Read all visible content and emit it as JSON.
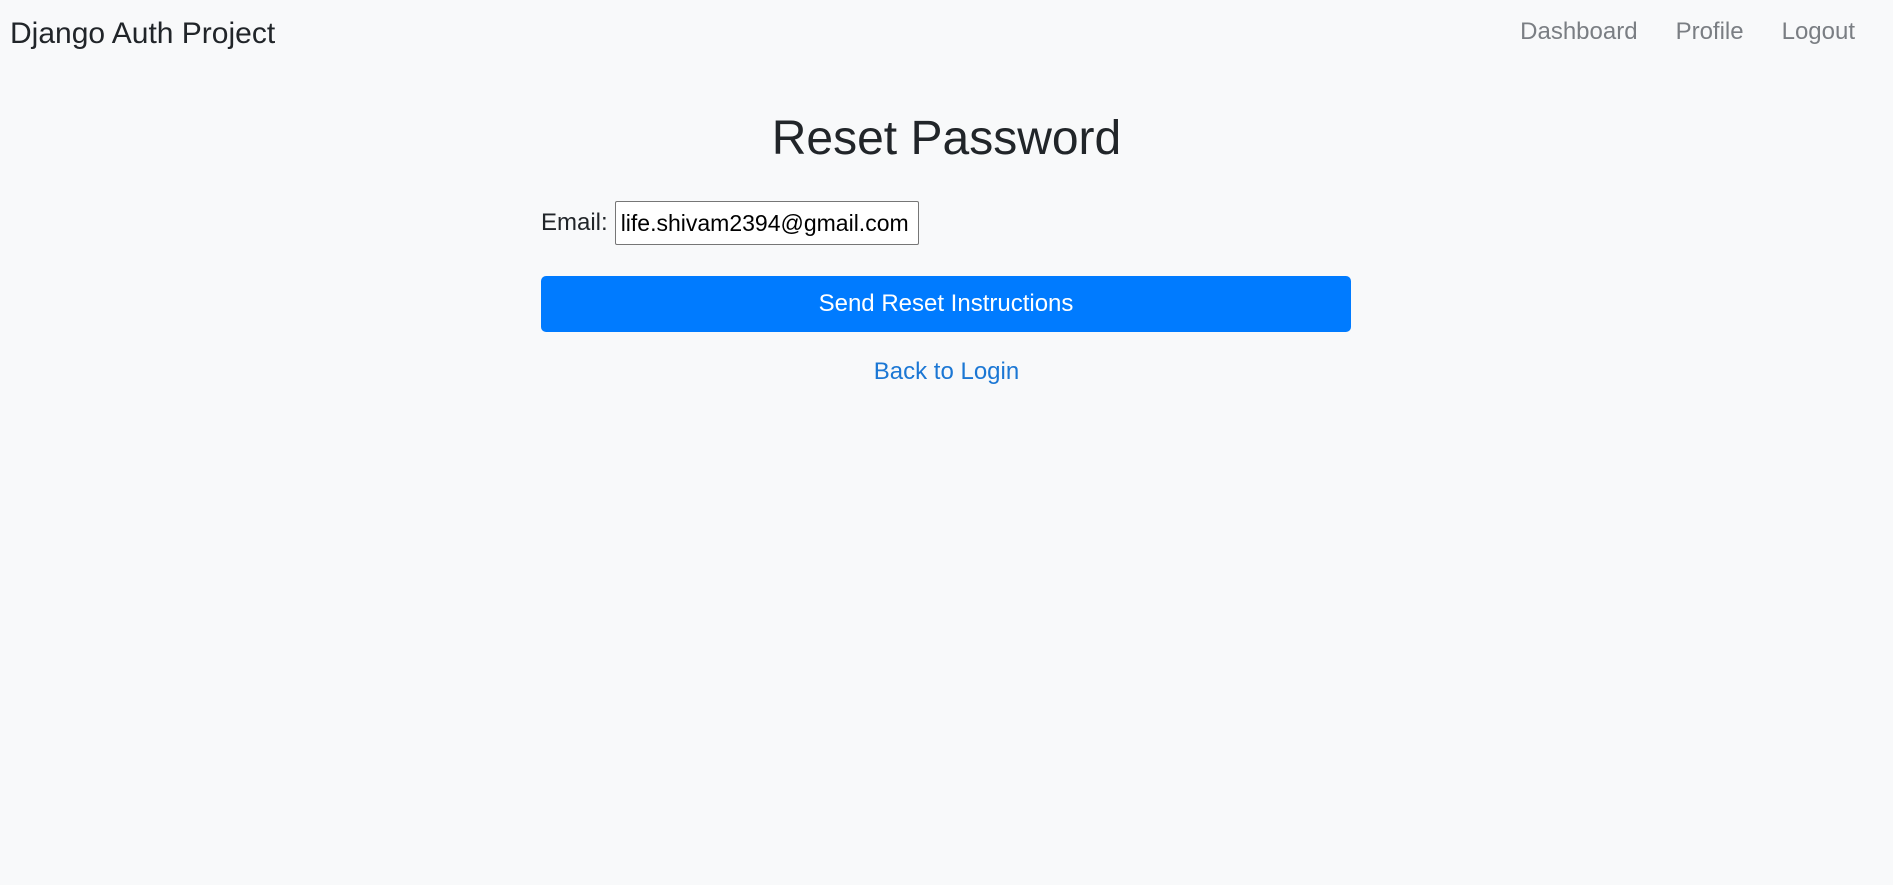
{
  "navbar": {
    "brand": "Django Auth Project",
    "links": [
      {
        "label": "Dashboard"
      },
      {
        "label": "Profile"
      },
      {
        "label": "Logout"
      }
    ]
  },
  "page": {
    "title": "Reset Password"
  },
  "form": {
    "email_label": "Email:",
    "email_value": "life.shivam2394@gmail.com",
    "submit_label": "Send Reset Instructions"
  },
  "back_link": {
    "label": "Back to Login"
  },
  "colors": {
    "background": "#f8f9fa",
    "primary": "#007bff",
    "link": "#1b77d4",
    "nav_link": "#7a7e83",
    "text": "#212529"
  }
}
